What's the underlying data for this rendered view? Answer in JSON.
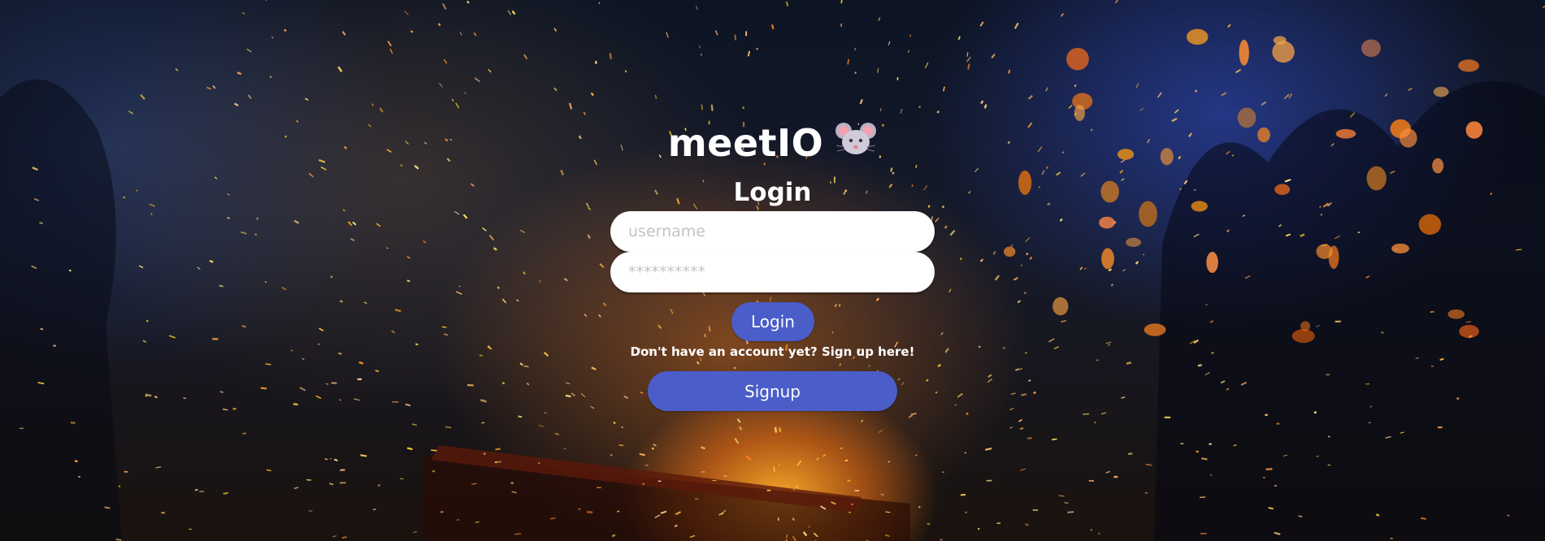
{
  "app": {
    "title": "meetIO",
    "title_icon": "mouse-face-icon"
  },
  "form": {
    "heading": "Login",
    "username": {
      "placeholder": "username",
      "value": ""
    },
    "password": {
      "placeholder": "**********",
      "value": ""
    },
    "login_label": "Login",
    "signup_hint": "Don't have an account yet? Sign up here!",
    "signup_label": "Signup"
  },
  "colors": {
    "button": "#4a5dc9",
    "text": "#ffffff",
    "input_bg": "#ffffff",
    "placeholder": "#c3c3c3"
  },
  "background": {
    "description_icon": "campfire-sparks-background"
  }
}
